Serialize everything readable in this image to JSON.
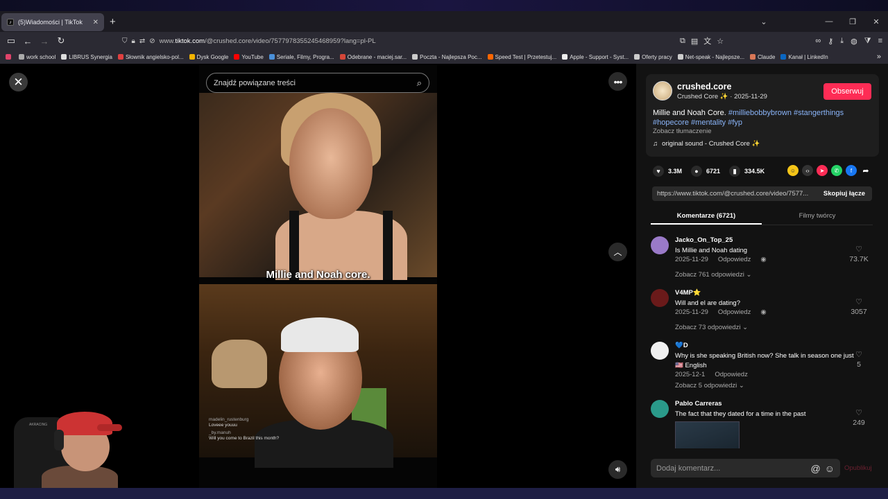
{
  "browser": {
    "tab_title": "(5)Wiadomości | TikTok",
    "url_prefix": "www.",
    "url_domain": "tiktok.com",
    "url_path": "/@crushed.core/video/7577978355245468959?lang=pl-PL",
    "bookmarks": [
      {
        "label": "",
        "color": "#e0436a"
      },
      {
        "label": "work school",
        "color": "#aaaaaa"
      },
      {
        "label": "LIBRUS Synergia",
        "color": "#dddddd"
      },
      {
        "label": "Słownik angielsko-pol...",
        "color": "#e04040"
      },
      {
        "label": "Dysk Google",
        "color": "#f4b400"
      },
      {
        "label": "YouTube",
        "color": "#ff0000"
      },
      {
        "label": "Seriale, Filmy, Progra...",
        "color": "#4a90d9"
      },
      {
        "label": "Odebrane - maciej.sar...",
        "color": "#d44638"
      },
      {
        "label": "Poczta - Najlepsza Poc...",
        "color": "#cccccc"
      },
      {
        "label": "Speed Test | Przetestuj...",
        "color": "#ff6600"
      },
      {
        "label": "Apple - Support - Syst...",
        "color": "#eeeeee"
      },
      {
        "label": "Oferty pracy",
        "color": "#cccccc"
      },
      {
        "label": "Net-speak - Najlepsze...",
        "color": "#cccccc"
      },
      {
        "label": "Claude",
        "color": "#d97757"
      },
      {
        "label": "Kanał | LinkedIn",
        "color": "#0a66c2"
      }
    ]
  },
  "video": {
    "search_placeholder": "Znajdź powiązane treści",
    "caption": "Millie and Noah core.",
    "live_comments": [
      {
        "name": "madelin_rustenburg",
        "text": "Loveee youuu"
      },
      {
        "name": "_by.manuh",
        "text": "Will you come to Brazil this month?"
      }
    ],
    "chair_brand": "AKRACING"
  },
  "post": {
    "username": "crushed.core",
    "display_name": "Crushed Core ✨",
    "date": "2025-11-29",
    "follow_label": "Obserwuj",
    "desc_text": "Millie and Noah Core.",
    "hashtags_line1": "#milliebobbybrown #stangerthings",
    "hashtags_line2": "#hopecore #mentality #fyp",
    "translate_label": "Zobacz tłumaczenie",
    "sound": "original sound - Crushed Core ✨",
    "likes": "3.3M",
    "comments": "6721",
    "saves": "334.5K",
    "link": "https://www.tiktok.com/@crushed.core/video/7577...",
    "copy_label": "Skopiuj łącze"
  },
  "tabs": {
    "comments": "Komentarze (6721)",
    "creator_videos": "Filmy twórcy"
  },
  "comments": [
    {
      "user": "Jacko_On_Top_25",
      "text": "Is Millie and Noah dating",
      "date": "2025-11-29",
      "reply": "Odpowiedz",
      "likes": "73.7K",
      "replies": "Zobacz 761 odpowiedzi",
      "color": "#9a7ac8"
    },
    {
      "user": "V4MP⭐",
      "text": "Will and el are dating?",
      "date": "2025-11-29",
      "reply": "Odpowiedz",
      "likes": "3057",
      "replies": "Zobacz 73 odpowiedzi",
      "color": "#6a1a1a"
    },
    {
      "user": "💙D",
      "text": "Why is she speaking British now? She talk in season one just 🇺🇸 English",
      "date": "2025-12-1",
      "reply": "Odpowiedz",
      "likes": "5",
      "replies": "Zobacz 5 odpowiedzi",
      "color": "#f0f0f0"
    },
    {
      "user": "Pablo Carreras",
      "text": "The fact that they dated for a time in the past",
      "likes": "249",
      "color": "#2a9a8a"
    }
  ],
  "comment_input": {
    "placeholder": "Dodaj komentarz...",
    "publish_label": "Opublikuj"
  }
}
